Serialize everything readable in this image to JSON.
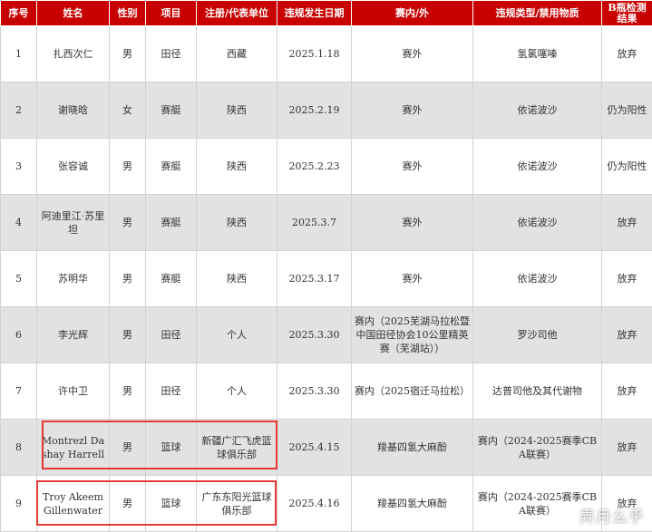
{
  "headers": [
    "序号",
    "姓名",
    "性别",
    "项目",
    "注册/代表单位",
    "违规发生日期",
    "赛内/外",
    "违规类型/禁用物质",
    "B瓶检测结果"
  ],
  "rows": [
    [
      "1",
      "扎西次仁",
      "男",
      "田径",
      "西藏",
      "2025.1.18",
      "赛外",
      "氢氯噻嗪",
      "放弃"
    ],
    [
      "2",
      "谢晓晗",
      "女",
      "赛艇",
      "陕西",
      "2025.2.19",
      "赛外",
      "依诺波沙",
      "仍为阳性"
    ],
    [
      "3",
      "张容诚",
      "男",
      "赛艇",
      "陕西",
      "2025.2.23",
      "赛外",
      "依诺波沙",
      "仍为阳性"
    ],
    [
      "4",
      "阿迪里江·苏里坦",
      "男",
      "赛艇",
      "陕西",
      "2025.3.7",
      "赛外",
      "依诺波沙",
      "放弃"
    ],
    [
      "5",
      "苏明华",
      "男",
      "赛艇",
      "陕西",
      "2025.3.17",
      "赛外",
      "依诺波沙",
      "放弃"
    ],
    [
      "6",
      "李光辉",
      "男",
      "田径",
      "个人",
      "2025.3.30",
      "赛内（2025芜湖马拉松暨中国田径协会10公里精英赛（芜湖站））",
      "罗沙司他",
      "放弃"
    ],
    [
      "7",
      "许中卫",
      "男",
      "田径",
      "个人",
      "2025.3.30",
      "赛内（2025宿迁马拉松）",
      "达普司他及其代谢物",
      "放弃"
    ],
    [
      "8",
      "Montrezl Dashay Harrell",
      "男",
      "篮球",
      "新疆广汇飞虎篮球俱乐部",
      "2025.4.15",
      "羧基四氢大麻酚",
      "赛内（2024-2025赛季CBA联赛）",
      "放弃"
    ],
    [
      "9",
      "Troy Akeem Gillenwater",
      "男",
      "篮球",
      "广东东阳光篮球俱乐部",
      "2025.4.16",
      "羧基四氢大麻酚",
      "赛内（2024-2025赛季CBA联赛）",
      "放弃"
    ]
  ],
  "watermark": "弄月么乎",
  "colors": {
    "header_bg": "#c80000",
    "even_row_bg": "#e2e2e2",
    "highlight": "#e53935"
  }
}
